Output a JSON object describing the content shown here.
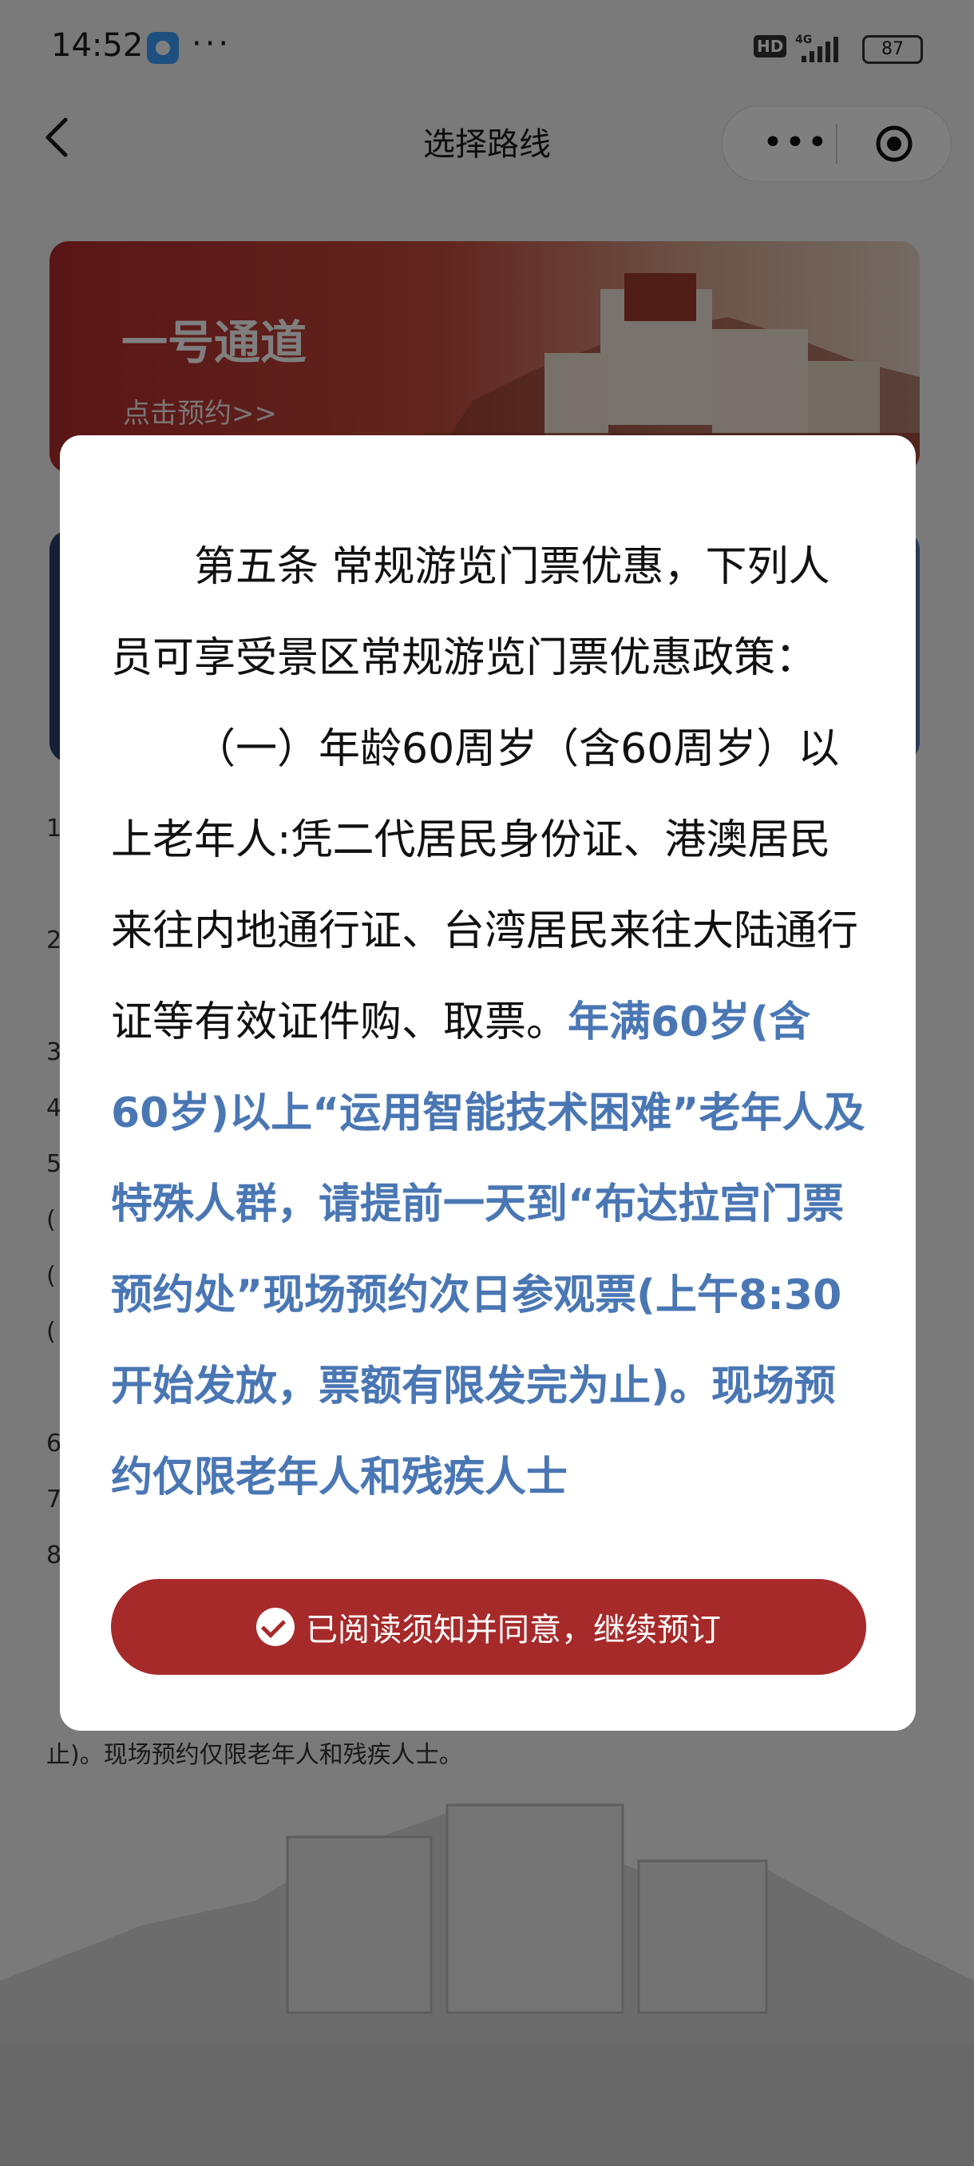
{
  "status_bar": {
    "time": "14:52",
    "more": "···",
    "hd": "HD",
    "network": "4G",
    "battery": "87"
  },
  "nav": {
    "title": "选择路线",
    "capsule_more": "•••"
  },
  "cards": [
    {
      "title": "一号通道",
      "subtitle": "点击预约>>"
    }
  ],
  "notes": {
    "numbers": [
      "1",
      "2",
      "3",
      "4",
      "5",
      "(",
      "(",
      "(",
      "6",
      "7",
      "8"
    ],
    "tail": "止)。现场预约仅限老年人和残疾人士。"
  },
  "dialog": {
    "para1": "第五条 常规游览门票优惠，下列人员可享受景区常规游览门票优惠政策：",
    "para2_normal": "（一）年龄60周岁（含60周岁）以上老年人:凭二代居民身份证、港澳居民来往内地通行证、台湾居民来往大陆通行证等有效证件购、取票。",
    "para2_highlight": "年满60岁(含60岁)以上“运用智能技术困难”老年人及特殊人群，请提前一天到“布达拉宫门票预约处”现场预约次日参观票(上午8:30开始发放，票额有限发完为止)。现场预约仅限老年人和残疾人士",
    "confirm_label": "已阅读须知并同意，继续预订"
  },
  "colors": {
    "primary_red": "#a72a2a",
    "highlight_blue": "#4a77b4",
    "overlay": "rgba(0,0,0,0.5)"
  }
}
